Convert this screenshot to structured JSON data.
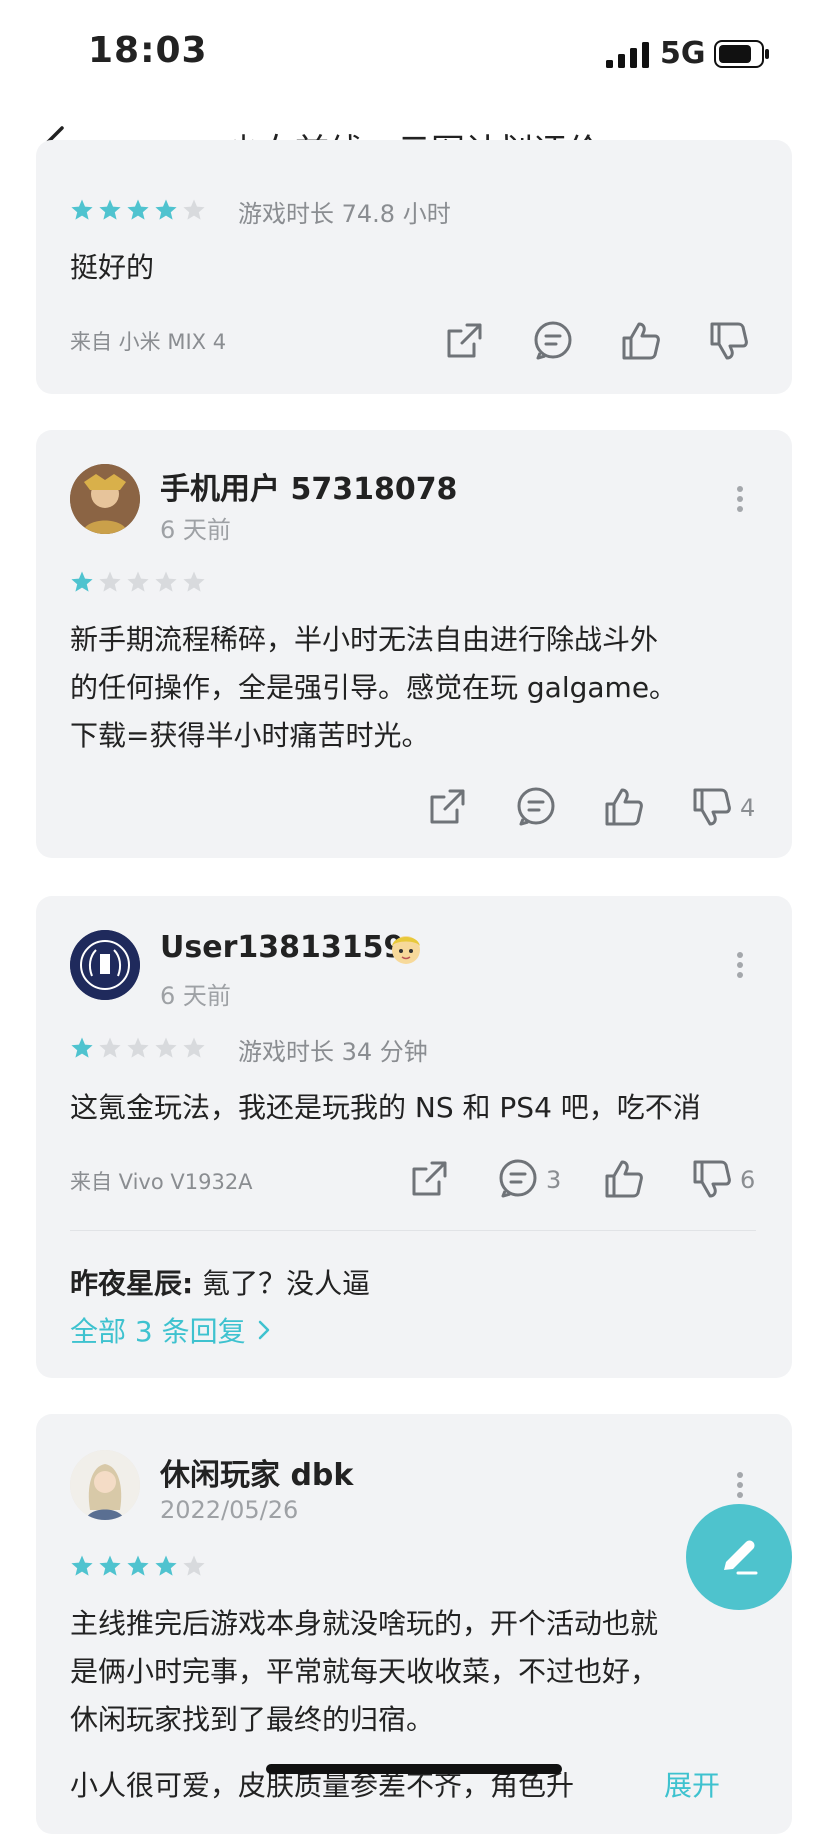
{
  "status": {
    "time": "18:03",
    "network": "5G"
  },
  "header": {
    "title": "少女前线：云图计划评价"
  },
  "reviews": [
    {
      "rating": 4,
      "playtime": "游戏时长 74.8 小时",
      "text": "挺好的",
      "device": "来自 小米 MIX 4"
    },
    {
      "username": "手机用户 57318078",
      "time": "6 天前",
      "rating": 1,
      "lines": [
        "新手期流程稀碎，半小时无法自由进行除战斗外",
        "的任何操作，全是强引导。感觉在玩 galgame。",
        "下载=获得半小时痛苦时光。"
      ],
      "dislikes": "4"
    },
    {
      "username": "User13813159",
      "time": "6 天前",
      "rating": 1,
      "playtime": "游戏时长 34 分钟",
      "text": "这氪金玩法，我还是玩我的 NS 和 PS4 吧，吃不消",
      "device": "来自 Vivo V1932A",
      "comments": "3",
      "dislikes": "6",
      "reply_author": "昨夜星辰:",
      "reply_text": " 氪了？没人逼",
      "all_replies": "全部 3 条回复"
    },
    {
      "username": "休闲玩家 dbk",
      "time": "2022/05/26",
      "rating": 4,
      "lines": [
        "主线推完后游戏本身就没啥玩的，开个活动也就",
        "是俩小时完事，平常就每天收收菜，不过也好，",
        "休闲玩家找到了最终的归宿。"
      ],
      "partial_line": "小人很可爱，皮肤质量参差不齐，角色升",
      "expand": "展开"
    }
  ],
  "colors": {
    "accent": "#3ec2cf",
    "star_on": "#4fc3cf",
    "star_off": "#d8dadd",
    "card_bg": "#f2f3f5",
    "fab": "#4ec3cd"
  }
}
